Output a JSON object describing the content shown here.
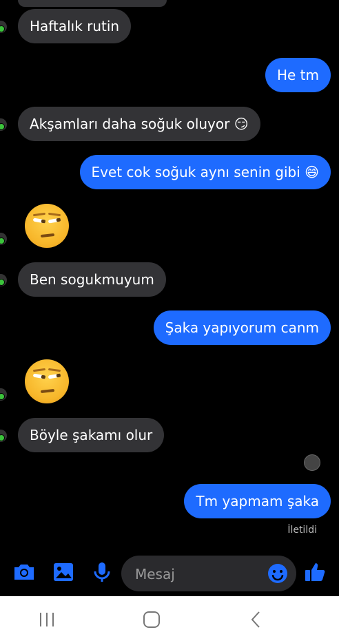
{
  "messages": {
    "m1": "Haftalık rutin",
    "m2": "He tm",
    "m3": "Akşamları daha soğuk oluyor 😏",
    "m4": "Evet cok soğuk aynı senin gibi 😄",
    "m5": "Ben sogukmuyum",
    "m6": "Şaka yapıyorum canm",
    "m7": "Böyle şakamı olur",
    "m8": "Tm yapmam şaka"
  },
  "status": {
    "delivered": "İletildi"
  },
  "composer": {
    "placeholder": "Mesaj"
  },
  "icons": {
    "camera": "camera-icon",
    "gallery": "gallery-icon",
    "mic": "microphone-icon",
    "emoji": "emoji-icon",
    "like": "thumbs-up-icon"
  },
  "colors": {
    "outgoing": "#1e6bff",
    "incoming": "#333336",
    "accent": "#1e6bff"
  }
}
